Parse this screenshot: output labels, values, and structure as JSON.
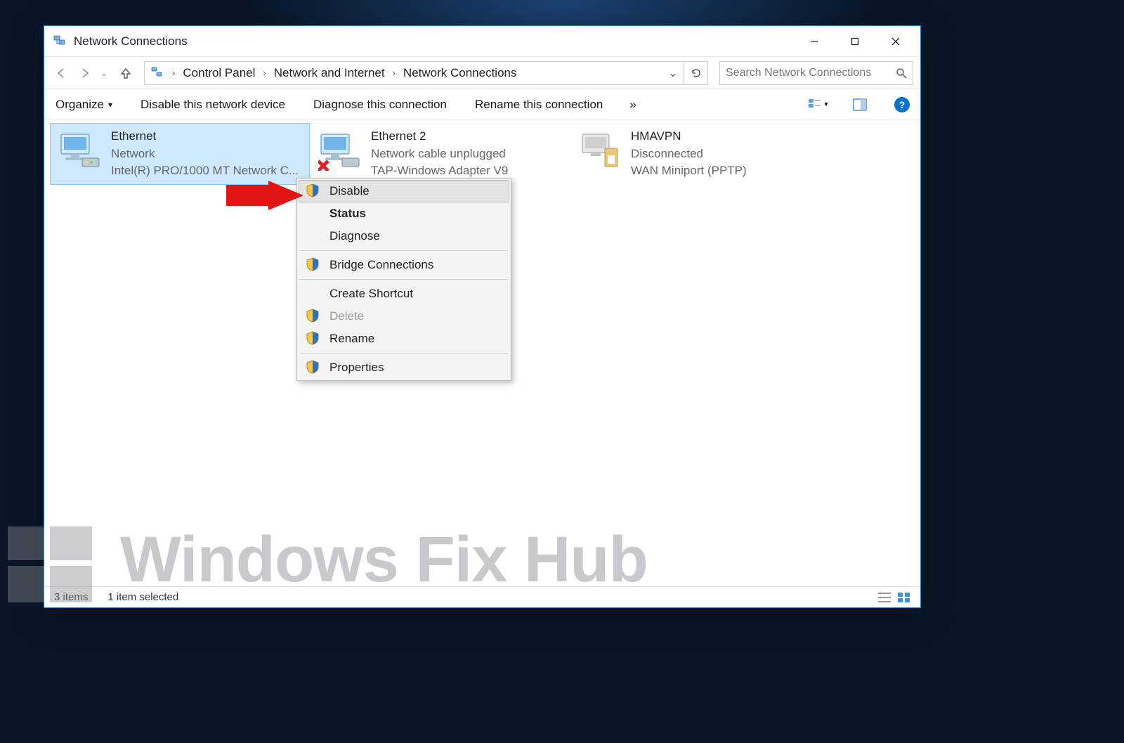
{
  "window": {
    "title": "Network Connections"
  },
  "breadcrumb": {
    "item0": "Control Panel",
    "item1": "Network and Internet",
    "item2": "Network Connections"
  },
  "search": {
    "placeholder": "Search Network Connections"
  },
  "toolbar": {
    "organize": "Organize",
    "disable": "Disable this network device",
    "diagnose": "Diagnose this connection",
    "rename": "Rename this connection"
  },
  "adapters": {
    "a0": {
      "name": "Ethernet",
      "status": "Network",
      "desc": "Intel(R) PRO/1000 MT Network C..."
    },
    "a1": {
      "name": "Ethernet 2",
      "status": "Network cable unplugged",
      "desc": "TAP-Windows Adapter V9"
    },
    "a2": {
      "name": "HMAVPN",
      "status": "Disconnected",
      "desc": "WAN Miniport (PPTP)"
    }
  },
  "contextMenu": {
    "disable": "Disable",
    "status": "Status",
    "diagnose": "Diagnose",
    "bridge": "Bridge Connections",
    "shortcut": "Create Shortcut",
    "delete": "Delete",
    "rename": "Rename",
    "properties": "Properties"
  },
  "statusbar": {
    "items": "3 items",
    "selected": "1 item selected"
  },
  "watermark": "Windows Fix Hub"
}
